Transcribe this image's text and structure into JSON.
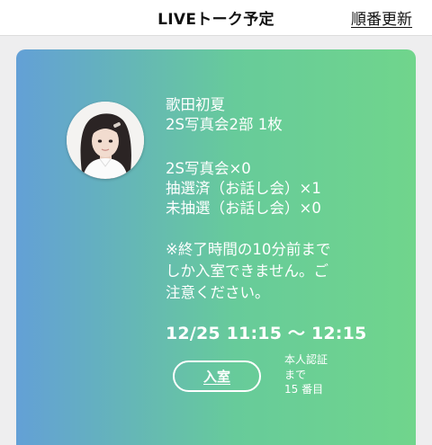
{
  "header": {
    "title": "LIVEトーク予定",
    "refresh_label": "順番更新"
  },
  "card": {
    "member_name": "歌田初夏",
    "event_line": "2S写真会2部 1枚",
    "ticket_counts": [
      "2S写真会×0",
      "抽選済（お話し会）×1",
      "未抽選（お話し会）×0"
    ],
    "notice_lines": [
      "※終了時間の10分前まで",
      "しか入室できません。ご",
      "注意ください。"
    ],
    "time_range": "12/25 11:15 〜 12:15",
    "enter_label": "入室",
    "queue_lines": [
      "本人認証",
      "まで",
      "15 番目"
    ],
    "gradient_colors": [
      "#63a0d6",
      "#67cb9a",
      "#70d58c"
    ]
  }
}
